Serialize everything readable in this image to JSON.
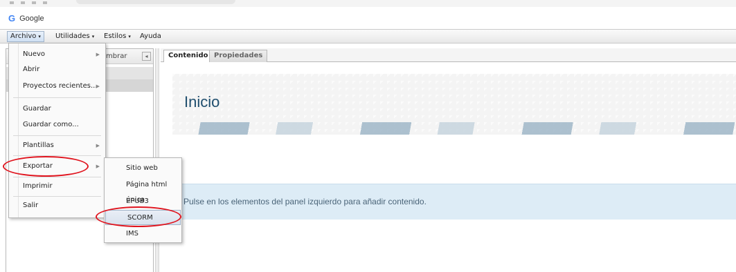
{
  "browser": {
    "bookmark": {
      "icon": "google-g-icon",
      "label": "Google",
      "letter": "G"
    }
  },
  "menubar": {
    "items": [
      {
        "label": "Archivo",
        "caret": "▾"
      },
      {
        "label": "Utilidades",
        "caret": "▾"
      },
      {
        "label": "Estilos",
        "caret": "▾"
      },
      {
        "label": "Ayuda",
        "caret": ""
      }
    ]
  },
  "left_panel": {
    "rename_label": "mbrar",
    "collapse_icon": "◂"
  },
  "tabs": [
    {
      "label": "Contenido",
      "active": true
    },
    {
      "label": "Propiedades",
      "active": false
    }
  ],
  "content": {
    "title": "Inicio",
    "info": "Pulse en los elementos del panel izquierdo para añadir contenido."
  },
  "archivo_menu": {
    "items": [
      {
        "label": "Nuevo",
        "submenu": true
      },
      {
        "label": "Abrir",
        "submenu": false
      },
      {
        "label": "Proyectos recientes...",
        "submenu": true
      },
      {
        "label": "Guardar",
        "submenu": false
      },
      {
        "label": "Guardar como...",
        "submenu": false
      },
      {
        "label": "Plantillas",
        "submenu": true
      },
      {
        "label": "Exportar",
        "submenu": true
      },
      {
        "label": "Imprimir",
        "submenu": false
      },
      {
        "label": "Salir",
        "submenu": false
      }
    ],
    "arrow": "▶"
  },
  "export_submenu": {
    "items": [
      {
        "label": "Sitio web"
      },
      {
        "label": "Página html única"
      },
      {
        "label": "EPUB3"
      },
      {
        "label": "SCORM"
      },
      {
        "label": "IMS"
      }
    ]
  },
  "annotations": {
    "color": "#e0141e"
  }
}
